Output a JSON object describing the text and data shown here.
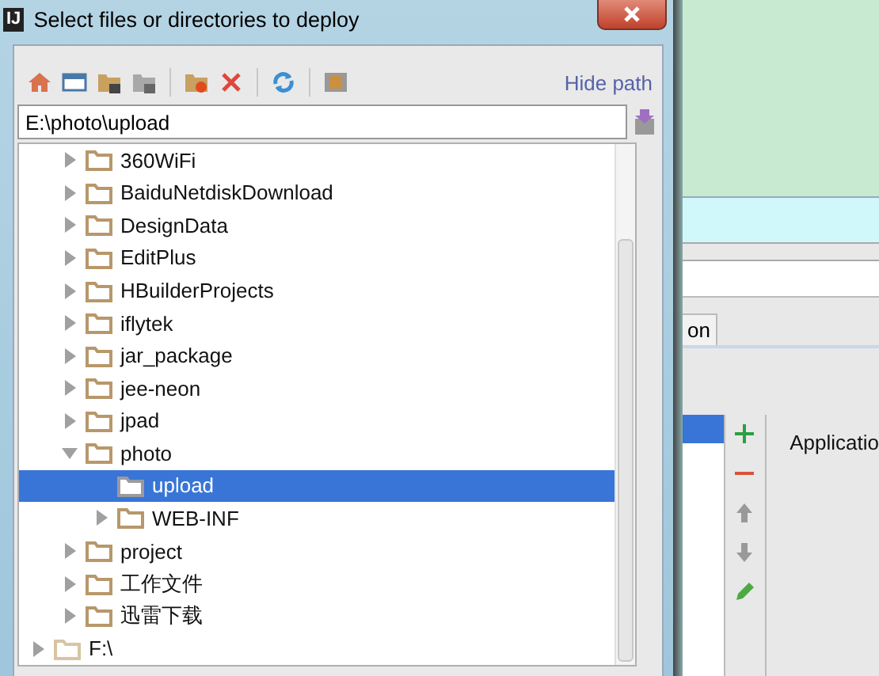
{
  "dialog": {
    "app_icon": "IJ",
    "title": "Select files or directories to deploy",
    "hide_path_link": "Hide path",
    "path": "E:\\photo\\upload",
    "folders": [
      {
        "label": "360WiFi",
        "expanded": false,
        "leaf": false,
        "selected": false
      },
      {
        "label": "BaiduNetdiskDownload",
        "expanded": false,
        "leaf": false,
        "selected": false
      },
      {
        "label": "DesignData",
        "expanded": false,
        "leaf": false,
        "selected": false
      },
      {
        "label": "EditPlus",
        "expanded": false,
        "leaf": false,
        "selected": false
      },
      {
        "label": "HBuilderProjects",
        "expanded": false,
        "leaf": false,
        "selected": false
      },
      {
        "label": "iflytek",
        "expanded": false,
        "leaf": false,
        "selected": false
      },
      {
        "label": "jar_package",
        "expanded": false,
        "leaf": false,
        "selected": false
      },
      {
        "label": "jee-neon",
        "expanded": false,
        "leaf": false,
        "selected": false
      },
      {
        "label": "jpad",
        "expanded": false,
        "leaf": false,
        "selected": false
      },
      {
        "label": "photo",
        "expanded": true,
        "leaf": false,
        "selected": false,
        "children": [
          {
            "label": "upload",
            "expanded": false,
            "leaf": true,
            "selected": true
          },
          {
            "label": "WEB-INF",
            "expanded": false,
            "leaf": false,
            "selected": false
          }
        ]
      },
      {
        "label": "project",
        "expanded": false,
        "leaf": false,
        "selected": false
      },
      {
        "label": "工作文件",
        "expanded": false,
        "leaf": false,
        "selected": false
      },
      {
        "label": "迅雷下载",
        "expanded": false,
        "leaf": false,
        "selected": false
      }
    ],
    "drives": [
      {
        "label": "F:\\",
        "expanded": false,
        "leaf": false,
        "selected": false
      }
    ]
  },
  "background_window": {
    "tab": "on",
    "list": [
      {
        "selected": true
      }
    ],
    "label": "Applicatio"
  }
}
